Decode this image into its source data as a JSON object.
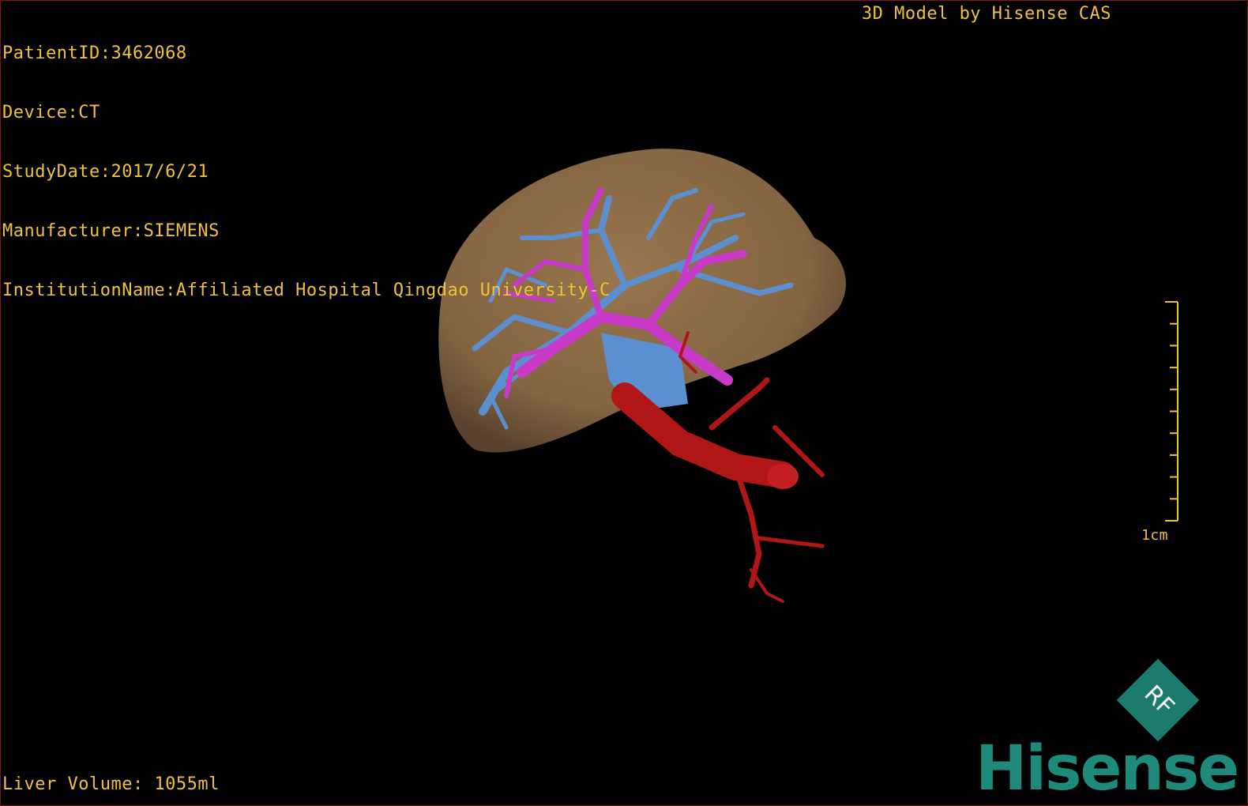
{
  "overlay": {
    "patient_id": "PatientID:3462068",
    "device": "Device:CT",
    "study_date": "StudyDate:2017/6/21",
    "manufacturer": "Manufacturer:SIEMENS",
    "institution": "InstitutionName:Affiliated Hospital Qingdao University-C",
    "brand": "3D Model by Hisense CAS",
    "liver_volume": "Liver Volume: 1055ml"
  },
  "scale_bar": {
    "label": "1cm",
    "tick_count": 10
  },
  "logo": {
    "badge_letters": "RF",
    "wordmark": "Hisense"
  },
  "colors": {
    "overlay_text": "#f0c23a",
    "liver": "#8a6a45",
    "portal_vein": "#5b8fd0",
    "hepatic_vein": "#c93ac9",
    "artery": "#b01616",
    "logo": "#1d8a7c"
  },
  "icons": {
    "logo_badge": "rf-diamond-icon"
  }
}
